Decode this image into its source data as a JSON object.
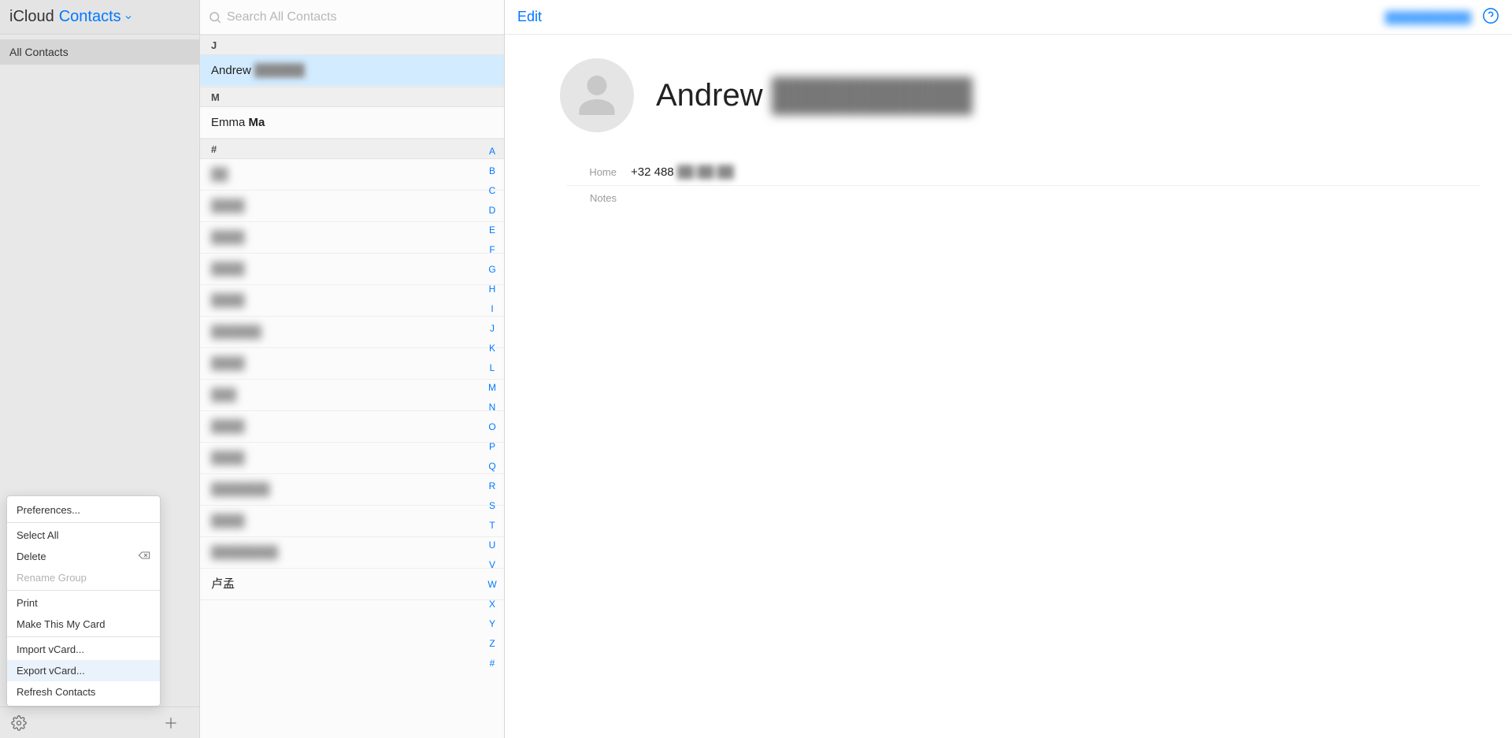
{
  "header": {
    "brand": "iCloud",
    "app_dropdown": "Contacts"
  },
  "sidebar": {
    "groups": [
      {
        "label": "All Contacts",
        "selected": true
      }
    ]
  },
  "footer": {
    "gear_icon": "gear-icon",
    "plus_icon": "plus-icon"
  },
  "menu": {
    "items": [
      {
        "label": "Preferences...",
        "enabled": true
      },
      {
        "sep": true
      },
      {
        "label": "Select All",
        "enabled": true
      },
      {
        "label": "Delete",
        "enabled": true,
        "kbd": "⌫"
      },
      {
        "label": "Rename Group",
        "enabled": false
      },
      {
        "sep": true
      },
      {
        "label": "Print",
        "enabled": true
      },
      {
        "label": "Make This My Card",
        "enabled": true
      },
      {
        "sep": true
      },
      {
        "label": "Import vCard...",
        "enabled": true
      },
      {
        "label": "Export vCard...",
        "enabled": true,
        "highlight": true
      },
      {
        "label": "Refresh Contacts",
        "enabled": true
      }
    ]
  },
  "search": {
    "placeholder": "Search All Contacts"
  },
  "list": {
    "sections": [
      {
        "header": "J",
        "rows": [
          {
            "first": "Andrew",
            "last_blur": "██████",
            "selected": true
          }
        ]
      },
      {
        "header": "M",
        "rows": [
          {
            "first": "Emma",
            "last_bold": "Ma"
          }
        ]
      },
      {
        "header": "#",
        "rows": [
          {
            "blur": "██"
          },
          {
            "blur": "████"
          },
          {
            "blur": "████"
          },
          {
            "blur": "████"
          },
          {
            "blur": "████"
          },
          {
            "blur": "██████"
          },
          {
            "blur": "████"
          },
          {
            "blur": "███"
          },
          {
            "blur": "████"
          },
          {
            "blur": "████"
          },
          {
            "blur": "███████"
          },
          {
            "blur": "████"
          },
          {
            "blur": "████████"
          },
          {
            "first_plain": "卢孟"
          }
        ]
      }
    ],
    "index": [
      "A",
      "B",
      "C",
      "D",
      "E",
      "F",
      "G",
      "H",
      "I",
      "J",
      "K",
      "L",
      "M",
      "N",
      "O",
      "P",
      "Q",
      "R",
      "S",
      "T",
      "U",
      "V",
      "W",
      "X",
      "Y",
      "Z",
      "#"
    ]
  },
  "detail": {
    "edit": "Edit",
    "account_blur": "███████████",
    "first_name": "Andrew",
    "last_name_blur": "█████████",
    "fields": [
      {
        "label": "Home",
        "value_prefix": "+32 488",
        "value_blur": "██ ██ ██"
      }
    ],
    "notes_label": "Notes"
  }
}
